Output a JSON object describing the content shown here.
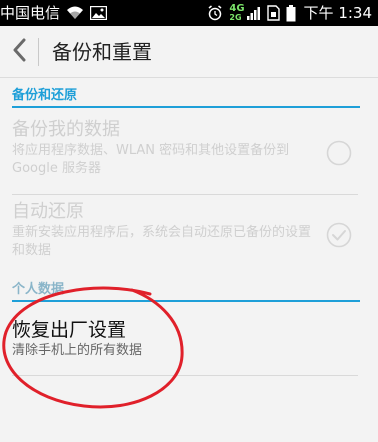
{
  "status_bar": {
    "carrier": "中国电信",
    "time": "下午 1:34",
    "network_top": "4G",
    "network_bottom": "2G"
  },
  "header": {
    "title": "备份和重置"
  },
  "sections": {
    "backup": {
      "label": "备份和还原",
      "items": [
        {
          "title": "备份我的数据",
          "summary": "将应用程序数据、WLAN 密码和其他设置备份到 Google 服务器"
        },
        {
          "title": "自动还原",
          "summary": "重新安装应用程序后，系统会自动还原已备份的设置和数据"
        }
      ]
    },
    "personal": {
      "label": "个人数据",
      "items": [
        {
          "title": "恢复出厂设置",
          "summary": "清除手机上的所有数据"
        }
      ]
    }
  },
  "colors": {
    "accent": "#1e9fd8",
    "annotation": "#e0202a",
    "disabled_text": "#cfcfcf"
  },
  "icons": {
    "back": "chevron-left-icon",
    "wifi": "wifi-icon",
    "image": "image-icon",
    "alarm": "alarm-icon",
    "signal": "signal-icon",
    "sim": "sim-icon",
    "battery": "battery-icon",
    "backup_control": "empty-checkbox-icon",
    "restore_control": "checkmark-circle-icon"
  }
}
